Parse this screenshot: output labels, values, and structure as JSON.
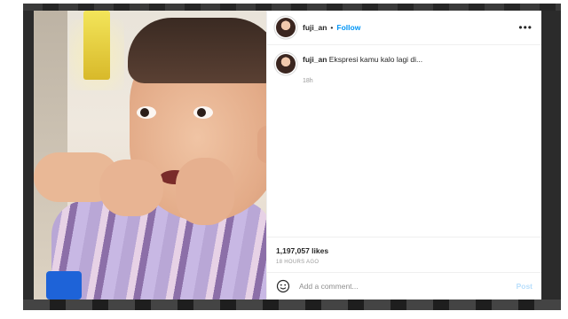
{
  "post": {
    "username": "fuji_an",
    "separator": "•",
    "follow_label": "Follow",
    "more_icon": "more-horizontal-icon",
    "caption": "Ekspresi kamu kalo lagi di...",
    "relative_time": "18h",
    "likes": "1,197,057 likes",
    "posted_ago": "18 HOURS AGO"
  },
  "comment": {
    "emoji_icon": "smiley-face-icon",
    "placeholder": "Add a comment...",
    "post_label": "Post"
  },
  "colors": {
    "link": "#0095f6",
    "post_disabled": "#b9dffc",
    "text": "#262626",
    "muted": "#8e8e8e"
  }
}
